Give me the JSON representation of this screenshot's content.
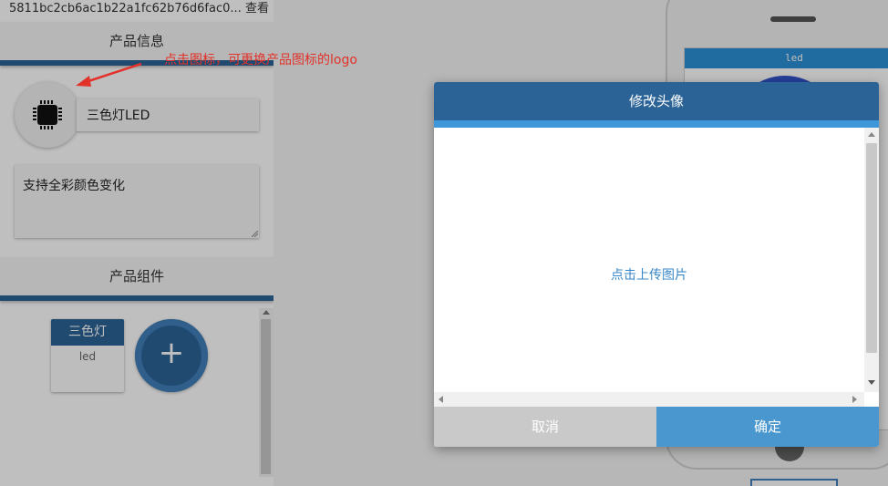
{
  "left_panel": {
    "product_id": "5811bc2cb6ac1b22a1fc62b76d6fac0...",
    "view_link": "查看",
    "info_header": "产品信息",
    "product_name": "三色灯LED",
    "product_desc": "支持全彩颜色变化",
    "components_header": "产品组件",
    "component": {
      "title": "三色灯",
      "subtitle": "led"
    },
    "add_button": "+"
  },
  "annotation": {
    "text": "点击图标，可更换产品图标的logo",
    "color": "#e2322a"
  },
  "phone_preview": {
    "bar_label": "led"
  },
  "modal": {
    "title": "修改头像",
    "upload_text": "点击上传图片",
    "cancel_label": "取消",
    "confirm_label": "确定"
  },
  "colors": {
    "primary": "#2b6396",
    "accent": "#3d97d8",
    "confirm": "#4a97d0",
    "cancel": "#c9c9c9"
  },
  "icons": [
    "chip-icon",
    "plus-icon",
    "arrow-icon"
  ]
}
